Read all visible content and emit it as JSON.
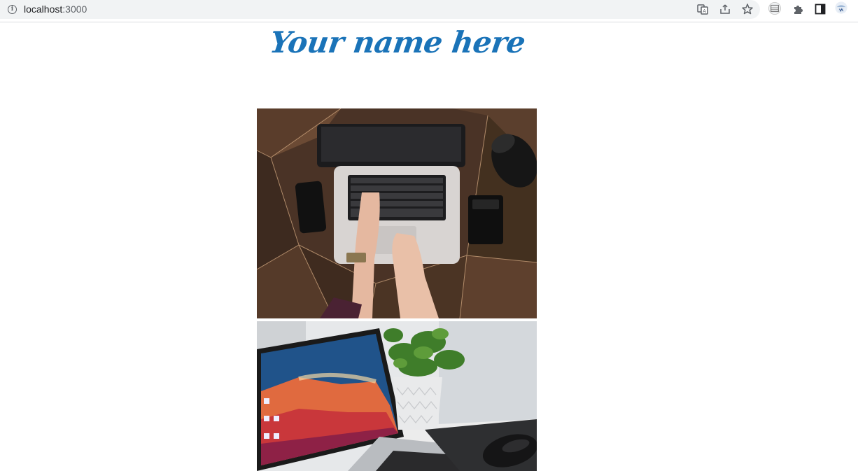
{
  "browser": {
    "url_host": "localhost",
    "url_port": ":3000",
    "icons": [
      "info-icon",
      "translate-icon",
      "share-icon",
      "bookmark-star-icon",
      "tab-search-icon",
      "extensions-icon",
      "side-panel-icon",
      "profile-avatar"
    ]
  },
  "page": {
    "title": "Your name here",
    "title_color": "#1a73b8",
    "images": [
      {
        "name": "laptop-on-wooden-desk-photo"
      },
      {
        "name": "laptop-with-plant-photo"
      }
    ]
  }
}
